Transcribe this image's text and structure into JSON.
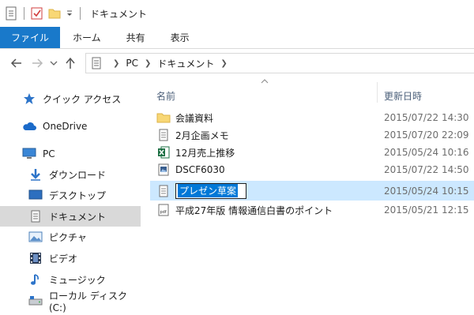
{
  "titlebar": {
    "title": "ドキュメント",
    "icons": [
      "properties-icon",
      "checklist-icon",
      "folder-icon",
      "dropdown-arrow-icon"
    ]
  },
  "ribbon": {
    "tabs": [
      {
        "label": "ファイル",
        "active": true
      },
      {
        "label": "ホーム"
      },
      {
        "label": "共有"
      },
      {
        "label": "表示"
      }
    ]
  },
  "address": {
    "crumbs": [
      "PC",
      "ドキュメント"
    ]
  },
  "navpane": {
    "items": [
      {
        "label": "クイック アクセス",
        "icon": "star-icon"
      },
      {
        "label": "OneDrive",
        "icon": "cloud-icon"
      },
      {
        "label": "PC",
        "icon": "computer-icon"
      },
      {
        "label": "ダウンロード",
        "icon": "download-icon"
      },
      {
        "label": "デスクトップ",
        "icon": "desktop-icon"
      },
      {
        "label": "ドキュメント",
        "icon": "document-icon",
        "selected": true
      },
      {
        "label": "ピクチャ",
        "icon": "picture-icon"
      },
      {
        "label": "ビデオ",
        "icon": "video-icon"
      },
      {
        "label": "ミュージック",
        "icon": "music-icon"
      },
      {
        "label": "ローカル ディスク (C:)",
        "icon": "drive-icon"
      }
    ]
  },
  "filelist": {
    "columns": {
      "name": "名前",
      "date": "更新日時"
    },
    "files": [
      {
        "name": "会議資料",
        "date": "2015/07/22 14:30",
        "icon": "folder-icon"
      },
      {
        "name": "2月企画メモ",
        "date": "2015/07/20 22:09",
        "icon": "text-file-icon"
      },
      {
        "name": "12月売上推移",
        "date": "2015/05/24 10:16",
        "icon": "excel-icon"
      },
      {
        "name": "DSCF6030",
        "date": "2015/07/22 14:50",
        "icon": "image-file-icon"
      },
      {
        "name": "プレゼン草案",
        "date": "2015/05/24 10:15",
        "icon": "text-file-icon",
        "renaming": true
      },
      {
        "name": "平成27年版 情報通信白書のポイント",
        "date": "2015/05/21 12:15",
        "icon": "pdf-icon"
      }
    ]
  },
  "colors": {
    "accent": "#1979ca",
    "selection": "#cce8ff",
    "nav_selected": "#d9d9d9",
    "header_text": "#4c607a"
  }
}
